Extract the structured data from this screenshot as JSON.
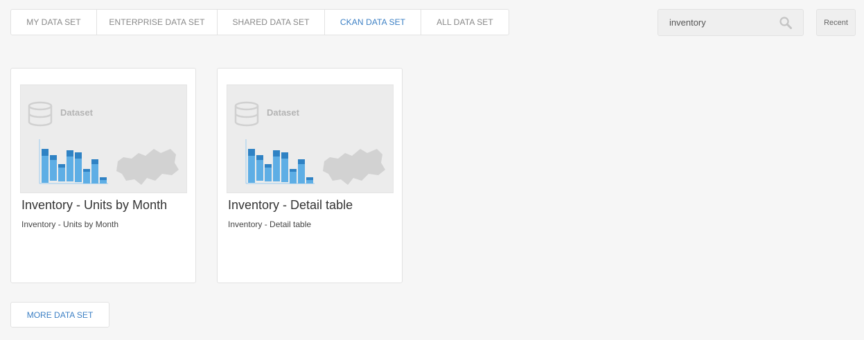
{
  "tabs": [
    {
      "label": "MY DATA SET"
    },
    {
      "label": "ENTERPRISE DATA SET"
    },
    {
      "label": "SHARED DATA SET"
    },
    {
      "label": "CKAN DATA SET"
    },
    {
      "label": "ALL DATA SET"
    }
  ],
  "active_tab": 3,
  "colors": {
    "accent": "#3b7fc4",
    "bar_light": "#5eaee5",
    "bar_dark": "#2f82c4"
  },
  "search": {
    "value": "inventory",
    "icon": "search-icon"
  },
  "recent_label": "Recent",
  "cards": [
    {
      "thumb_label": "Dataset",
      "title": "Inventory - Units by Month",
      "subtitle": "Inventory - Units by Month"
    },
    {
      "thumb_label": "Dataset",
      "title": "Inventory - Detail table",
      "subtitle": "Inventory - Detail table"
    }
  ],
  "more_label": "MORE DATA SET"
}
